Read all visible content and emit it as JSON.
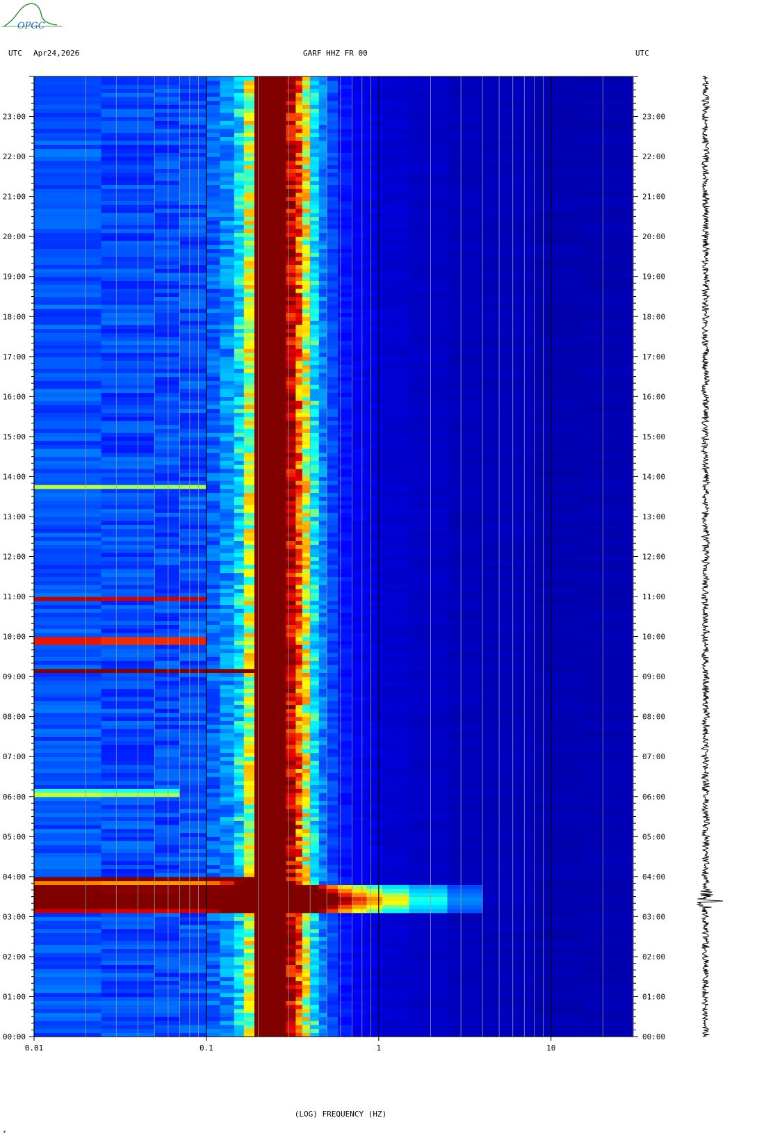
{
  "header": {
    "left_zone": "UTC",
    "date": "Apr24,2026",
    "station": "GARF HHZ FR 00",
    "right_zone": "UTC"
  },
  "logo": {
    "text": "OPGC"
  },
  "chart_data": {
    "type": "heatmap",
    "title": "GARF HHZ FR 00",
    "xlabel": "(LOG) FREQUENCY (HZ)",
    "ylabel": "UTC",
    "x_scale": "log",
    "xlim": [
      0.01,
      30
    ],
    "x_tick_labels": [
      "0.01",
      "0.1",
      "1",
      "10"
    ],
    "x_tick_values": [
      0.01,
      0.1,
      1,
      10
    ],
    "y_tick_labels": [
      "00:00",
      "01:00",
      "02:00",
      "03:00",
      "04:00",
      "05:00",
      "06:00",
      "07:00",
      "08:00",
      "09:00",
      "10:00",
      "11:00",
      "12:00",
      "13:00",
      "14:00",
      "15:00",
      "16:00",
      "17:00",
      "18:00",
      "19:00",
      "20:00",
      "21:00",
      "22:00",
      "23:00"
    ],
    "y_range_hours": [
      0,
      24
    ],
    "colormap": "jet",
    "colors": {
      "low": "#00008c",
      "high": "#800000"
    },
    "features": [
      {
        "label": "microseism peak",
        "freq_hz": [
          0.2,
          0.3
        ],
        "level": "max"
      },
      {
        "label": "event",
        "time_utc": "03:25",
        "freq_hz": [
          0.01,
          3
        ]
      },
      {
        "label": "event",
        "time_utc": "03:55",
        "freq_hz": [
          0.01,
          0.2
        ]
      },
      {
        "label": "event",
        "time_utc": "09:10",
        "freq_hz": [
          0.01,
          0.2
        ]
      },
      {
        "label": "event",
        "time_utc": "09:55",
        "freq_hz": [
          0.01,
          0.1
        ]
      },
      {
        "label": "event",
        "time_utc": "10:55",
        "freq_hz": [
          0.025,
          0.1
        ]
      },
      {
        "label": "event",
        "time_utc": "06:05",
        "freq_hz": [
          0.025,
          0.07
        ]
      },
      {
        "label": "event",
        "time_utc": "13:40",
        "freq_hz": [
          0.025,
          0.1
        ]
      }
    ],
    "waveform_event_time_utc": "03:25"
  },
  "footer": {
    "mark": "*"
  }
}
